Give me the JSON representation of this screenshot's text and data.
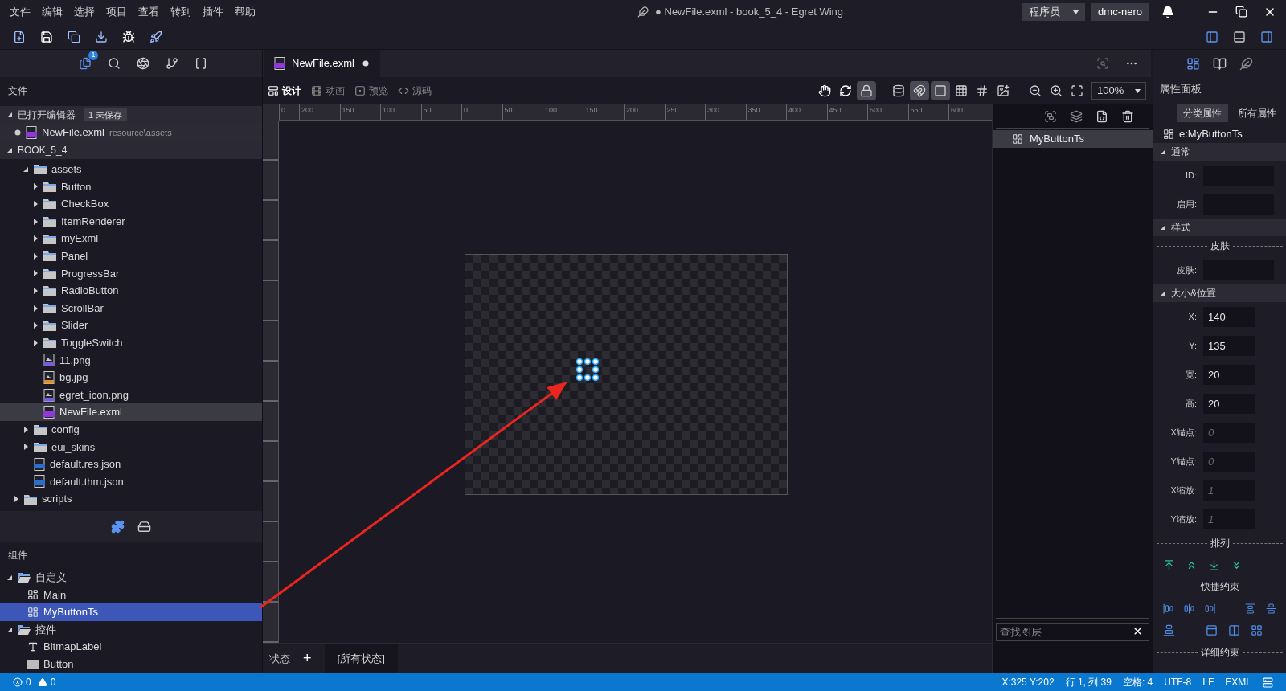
{
  "menu": [
    "文件",
    "编辑",
    "选择",
    "项目",
    "查看",
    "转到",
    "插件",
    "帮助"
  ],
  "title": "● NewFile.exml - book_5_4 - Egret Wing",
  "role_select": "程序员",
  "user": "dmc-nero",
  "activity_badge": "1",
  "explorer": {
    "title": "文件",
    "open_editors": {
      "label": "已打开编辑器",
      "badge": "1 未保存",
      "files": [
        {
          "name": "NewFile.exml",
          "path": "resource\\assets",
          "modified": true
        }
      ]
    },
    "project": {
      "label": "BOOK_5_4",
      "tree": [
        {
          "kind": "offscreen",
          "children": [
            {
              "name": "assets",
              "kind": "folder",
              "expanded": true,
              "selected": false,
              "children": [
                {
                  "name": "Button",
                  "kind": "folder",
                  "expanded": false,
                  "selected": false
                },
                {
                  "name": "CheckBox",
                  "kind": "folder",
                  "expanded": false,
                  "selected": false
                },
                {
                  "name": "ItemRenderer",
                  "kind": "folder",
                  "expanded": false,
                  "selected": false
                },
                {
                  "name": "myExml",
                  "kind": "folder",
                  "expanded": false,
                  "selected": false
                },
                {
                  "name": "Panel",
                  "kind": "folder",
                  "expanded": false,
                  "selected": false
                },
                {
                  "name": "ProgressBar",
                  "kind": "folder",
                  "expanded": false,
                  "selected": false
                },
                {
                  "name": "RadioButton",
                  "kind": "folder",
                  "expanded": false,
                  "selected": false
                },
                {
                  "name": "ScrollBar",
                  "kind": "folder",
                  "expanded": false,
                  "selected": false
                },
                {
                  "name": "Slider",
                  "kind": "folder",
                  "expanded": false,
                  "selected": false
                },
                {
                  "name": "ToggleSwitch",
                  "kind": "folder",
                  "expanded": false,
                  "selected": false
                },
                {
                  "name": "11.png",
                  "kind": "png",
                  "selected": false
                },
                {
                  "name": "bg.jpg",
                  "kind": "jpg",
                  "selected": false
                },
                {
                  "name": "egret_icon.png",
                  "kind": "png",
                  "selected": false
                },
                {
                  "name": "NewFile.exml",
                  "kind": "exml",
                  "selected": true
                }
              ]
            },
            {
              "name": "config",
              "kind": "folder",
              "expanded": false,
              "selected": false
            },
            {
              "name": "eui_skins",
              "kind": "folder",
              "expanded": false,
              "selected": false
            },
            {
              "name": "default.res.json",
              "kind": "json",
              "selected": false
            },
            {
              "name": "default.thm.json",
              "kind": "json",
              "selected": false
            }
          ]
        },
        {
          "name": "scripts",
          "kind": "folder",
          "expanded": false,
          "selected": false
        }
      ]
    }
  },
  "components": {
    "title": "组件",
    "tree": [
      {
        "name": "自定义",
        "kind": "group",
        "expanded": true,
        "selected": false,
        "children": [
          {
            "name": "Main",
            "kind": "component",
            "selected": false
          },
          {
            "name": "MyButtonTs",
            "kind": "component",
            "selected": true
          }
        ]
      },
      {
        "name": "控件",
        "kind": "group",
        "expanded": true,
        "selected": false,
        "children": [
          {
            "name": "BitmapLabel",
            "kind": "label",
            "selected": false
          },
          {
            "name": "Button",
            "kind": "button",
            "selected": false
          }
        ]
      }
    ]
  },
  "editor_tab": {
    "label": "NewFile.exml",
    "modified": true
  },
  "view_tabs": [
    {
      "label": "设计",
      "kind": "design",
      "selected": true
    },
    {
      "label": "动画",
      "kind": "animation",
      "selected": false
    },
    {
      "label": "预览",
      "kind": "preview",
      "selected": false
    },
    {
      "label": "源码",
      "kind": "source",
      "selected": false
    }
  ],
  "zoom": "100%",
  "ruler": [
    "0",
    "200",
    "150",
    "100",
    "50",
    "0",
    "50",
    "100",
    "150",
    "200",
    "250",
    "300",
    "350",
    "400",
    "450",
    "500",
    "550",
    "600"
  ],
  "layers": {
    "items": [
      {
        "name": "MyButtonTs",
        "selected": true
      }
    ],
    "search_placeholder": "查找图层"
  },
  "states": {
    "label": "状态",
    "add": "+",
    "current": "[所有状态]"
  },
  "properties": {
    "title": "属性面板",
    "tabs": [
      {
        "label": "分类属性",
        "selected": true
      },
      {
        "label": "所有属性",
        "selected": false
      }
    ],
    "element": "e:MyButtonTs",
    "items": [
      {
        "kind": "section",
        "label": "通常"
      },
      {
        "kind": "field",
        "label": "ID:"
      },
      {
        "kind": "field",
        "label": "启用:"
      },
      {
        "kind": "section",
        "label": "样式"
      },
      {
        "kind": "divider",
        "label": "皮肤"
      },
      {
        "kind": "field",
        "label": "皮肤:"
      },
      {
        "kind": "section",
        "label": "大小&位置"
      },
      {
        "kind": "field",
        "label": "X:",
        "value": "140"
      },
      {
        "kind": "field",
        "label": "Y:",
        "value": "135"
      },
      {
        "kind": "field",
        "label": "宽:",
        "value": "20"
      },
      {
        "kind": "field",
        "label": "高:",
        "value": "20"
      },
      {
        "kind": "field",
        "label": "X锚点:",
        "placeholder": "0"
      },
      {
        "kind": "field",
        "label": "Y锚点:",
        "placeholder": "0"
      },
      {
        "kind": "field",
        "label": "X缩放:",
        "placeholder": "1"
      },
      {
        "kind": "field",
        "label": "Y缩放:",
        "placeholder": "1"
      },
      {
        "kind": "divider",
        "label": "排列"
      },
      {
        "kind": "arrange_icons"
      },
      {
        "kind": "divider",
        "label": "快捷约束"
      },
      {
        "kind": "constraint_icons"
      },
      {
        "kind": "divider",
        "label": "详细约束"
      }
    ]
  },
  "status": {
    "errors": "0",
    "warnings": "0",
    "items": [
      "X:325 Y:202",
      "行 1, 列 39",
      "空格: 4",
      "UTF-8",
      "LF",
      "EXML"
    ]
  }
}
